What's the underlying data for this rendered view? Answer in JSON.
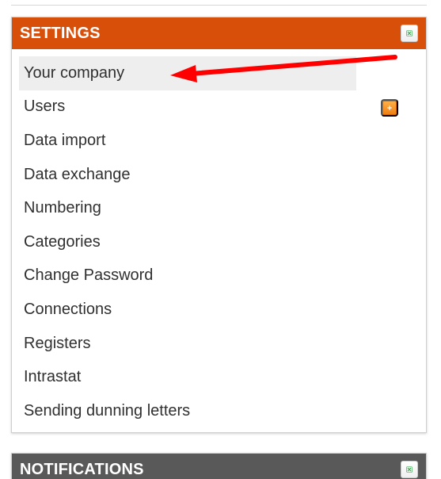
{
  "settings": {
    "title": "SETTINGS",
    "items": [
      {
        "label": "Your company"
      },
      {
        "label": "Users"
      },
      {
        "label": "Data import"
      },
      {
        "label": "Data exchange"
      },
      {
        "label": "Numbering"
      },
      {
        "label": "Categories"
      },
      {
        "label": "Change Password"
      },
      {
        "label": "Connections"
      },
      {
        "label": "Registers"
      },
      {
        "label": "Intrastat"
      },
      {
        "label": "Sending dunning letters"
      }
    ]
  },
  "notifications": {
    "title": "NOTIFICATIONS"
  },
  "colors": {
    "settings_header": "#d84f0a",
    "notifications_header": "#595959",
    "close_icon": "#2f9e44",
    "add_icon": "#ee7d10",
    "arrow": "#ff0000"
  },
  "icons": {
    "close": "close-icon",
    "add": "plus-icon",
    "annotation": "arrow-annotation"
  }
}
